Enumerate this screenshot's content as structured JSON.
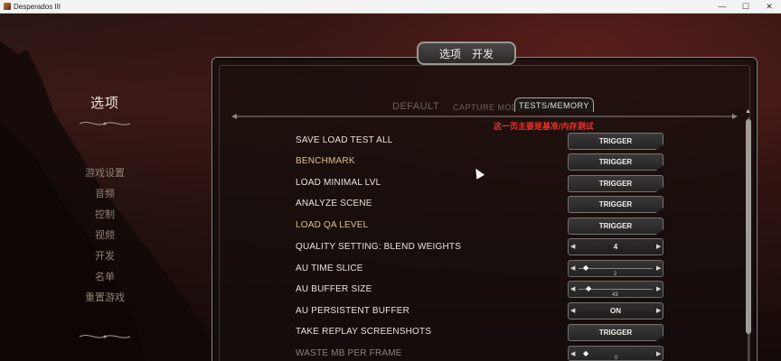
{
  "window": {
    "title": "Desperados III",
    "minimize": "—",
    "maximize": "☐",
    "close": "✕"
  },
  "left_menu": {
    "title": "选项",
    "items": [
      "游戏设置",
      "音频",
      "控制",
      "视频",
      "开发",
      "名单",
      "重置游戏"
    ]
  },
  "header": {
    "label_options": "选项",
    "label_dev": "开发"
  },
  "tabs": [
    "DEFAULT",
    "CAPTURE MODE",
    "TESTS/MEMORY"
  ],
  "note": "这一页主要是基准/内存测试",
  "rows": [
    {
      "label": "SAVE LOAD TEST ALL",
      "control": "TRIGGER"
    },
    {
      "label": "BENCHMARK",
      "control": "TRIGGER"
    },
    {
      "label": "LOAD MINIMAL LVL",
      "control": "TRIGGER"
    },
    {
      "label": "ANALYZE SCENE",
      "control": "TRIGGER"
    },
    {
      "label": "LOAD QA LEVEL",
      "control": "TRIGGER"
    },
    {
      "label": "QUALITY SETTING: BLEND WEIGHTS",
      "control": "4"
    },
    {
      "label": "AU TIME SLICE",
      "control": "2"
    },
    {
      "label": "AU BUFFER SIZE",
      "control": "43"
    },
    {
      "label": "AU PERSISTENT BUFFER",
      "control": "ON"
    },
    {
      "label": "TAKE REPLAY SCREENSHOTS",
      "control": "TRIGGER"
    },
    {
      "label": "WASTE MB PER FRAME",
      "control": "0"
    }
  ],
  "colors": {
    "accent_gold": "#d9c08e",
    "note_red": "#e8322a"
  }
}
